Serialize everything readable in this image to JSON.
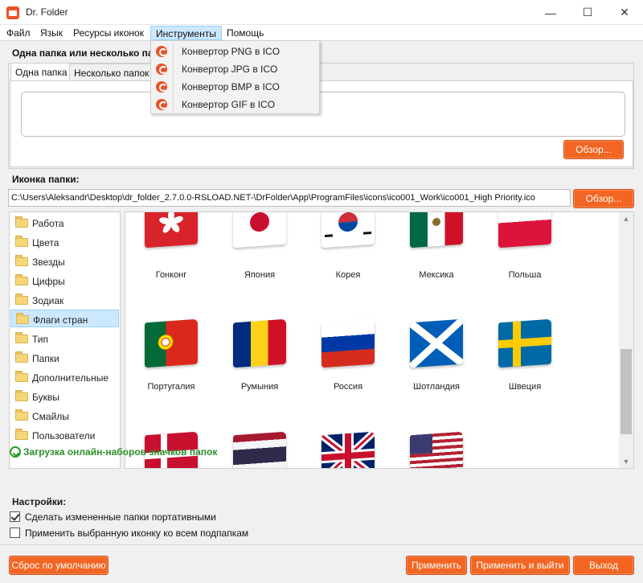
{
  "window": {
    "title": "Dr. Folder",
    "minimize": "—",
    "maximize": "☐",
    "close": "✕"
  },
  "menu": {
    "items": [
      "Файл",
      "Язык",
      "Ресурсы иконок",
      "Инструменты",
      "Помощь"
    ],
    "active_item": "Инструменты"
  },
  "tools_menu": {
    "items": [
      "Конвертор PNG в ICO",
      "Конвертор JPG в ICO",
      "Конвертор BMP в ICO",
      "Конвертор GIF в ICO"
    ]
  },
  "folder_group": {
    "title": "Одна папка или несколько папок",
    "tabs": [
      "Одна папка",
      "Несколько папок"
    ],
    "active_tab": "Одна папка",
    "folder_path_value": "",
    "browse_label": "Обзор..."
  },
  "icon_group": {
    "title": "Иконка папки:",
    "path_value": "C:\\Users\\Aleksandr\\Desktop\\dr_folder_2.7.0.0-RSLOAD.NET-\\DrFolder\\App\\ProgramFiles\\icons\\ico001_Work\\ico001_High Priority.ico",
    "browse_label": "Обзор..."
  },
  "categories": {
    "items": [
      "Работа",
      "Цвета",
      "Звезды",
      "Цифры",
      "Зодиак",
      "Флаги стран",
      "Тип",
      "Папки",
      "Дополнительные",
      "Буквы",
      "Смайлы",
      "Пользователи"
    ],
    "selected": "Флаги стран"
  },
  "download_link": "Загрузка онлайн-наборов значков папок",
  "icons": [
    {
      "label": "Гонконг",
      "icon": "hong-kong-flag-folder-icon"
    },
    {
      "label": "Япония",
      "icon": "japan-flag-folder-icon"
    },
    {
      "label": "Корея",
      "icon": "korea-flag-folder-icon"
    },
    {
      "label": "Мексика",
      "icon": "mexico-flag-folder-icon"
    },
    {
      "label": "Польша",
      "icon": "poland-flag-folder-icon"
    },
    {
      "label": "Португалия",
      "icon": "portugal-flag-folder-icon"
    },
    {
      "label": "Румыния",
      "icon": "romania-flag-folder-icon"
    },
    {
      "label": "Россия",
      "icon": "russia-flag-folder-icon"
    },
    {
      "label": "Шотландия",
      "icon": "scotland-flag-folder-icon"
    },
    {
      "label": "Швеция",
      "icon": "sweden-flag-folder-icon"
    },
    {
      "label": "",
      "icon": "denmark-flag-folder-icon"
    },
    {
      "label": "",
      "icon": "thailand-flag-folder-icon"
    },
    {
      "label": "",
      "icon": "uk-flag-folder-icon"
    },
    {
      "label": "",
      "icon": "usa-flag-folder-icon"
    }
  ],
  "settings": {
    "title": "Настройки:",
    "options": [
      {
        "label": "Сделать измененные папки портативными",
        "checked": true
      },
      {
        "label": "Применить выбранную иконку ко всем подпапкам",
        "checked": false
      }
    ]
  },
  "footer": {
    "reset_label": "Сброс по умолчанию",
    "apply_label": "Применить",
    "apply_exit_label": "Применить и выйти",
    "exit_label": "Выход"
  },
  "colors": {
    "accent": "#f26522",
    "selection": "#cce8ff",
    "link": "#2a8f2a"
  }
}
